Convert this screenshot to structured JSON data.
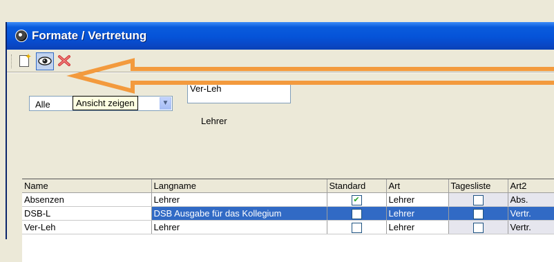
{
  "window": {
    "title": "Formate / Vertretung"
  },
  "toolbar": {
    "new_icon": "new-document-icon",
    "view_icon": "eye-icon",
    "delete_icon": "delete-x-icon"
  },
  "filter": {
    "select_value": "Alle",
    "tooltip": "Ansicht zeigen",
    "code_value": "Ver-Leh",
    "kind_label": "Lehrer"
  },
  "grid": {
    "columns": [
      "Name",
      "Langname",
      "Standard",
      "Art",
      "Tagesliste",
      "Art2"
    ],
    "rows": [
      {
        "name": "Absenzen",
        "langname": "Lehrer",
        "standard": true,
        "art": "Lehrer",
        "tagesliste": false,
        "art2": "Abs."
      },
      {
        "name": "DSB-L",
        "langname": "DSB Ausgabe für das Kollegium",
        "standard": false,
        "art": "Lehrer",
        "tagesliste": false,
        "art2": "Vertr."
      },
      {
        "name": "Ver-Leh",
        "langname": "Lehrer",
        "standard": false,
        "art": "Lehrer",
        "tagesliste": false,
        "art2": "Vertr."
      }
    ]
  },
  "annotation": {
    "arrow_color": "#f39a3d"
  }
}
